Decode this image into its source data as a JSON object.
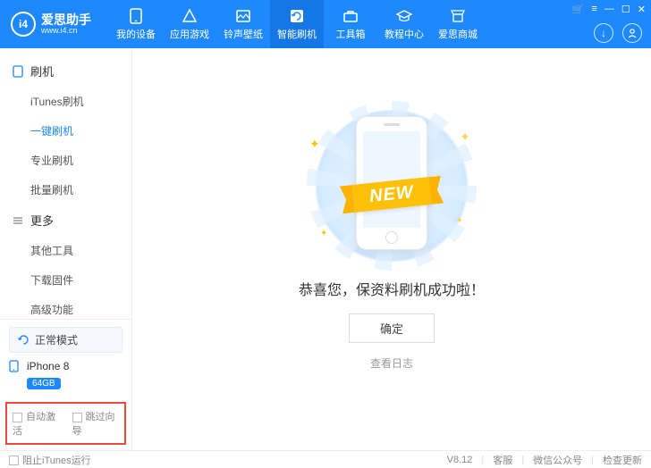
{
  "brand": {
    "name": "爱思助手",
    "site": "www.i4.cn",
    "badge": "i4"
  },
  "win": [
    "🛒",
    "≡",
    "—",
    "☐",
    "✕"
  ],
  "nav": [
    {
      "key": "device",
      "label": "我的设备"
    },
    {
      "key": "apps",
      "label": "应用游戏"
    },
    {
      "key": "ring",
      "label": "铃声壁纸"
    },
    {
      "key": "flash",
      "label": "智能刷机"
    },
    {
      "key": "tools",
      "label": "工具箱"
    },
    {
      "key": "tutorial",
      "label": "教程中心"
    },
    {
      "key": "mall",
      "label": "爱思商城"
    }
  ],
  "activeNav": 3,
  "sidebar": {
    "groups": [
      {
        "title": "刷机",
        "items": [
          "iTunes刷机",
          "一键刷机",
          "专业刷机",
          "批量刷机"
        ],
        "selected": 1
      },
      {
        "title": "更多",
        "items": [
          "其他工具",
          "下载固件",
          "高级功能"
        ],
        "selected": -1
      }
    ]
  },
  "mode": "正常模式",
  "device": {
    "name": "iPhone 8",
    "capacity": "64GB"
  },
  "opts": {
    "autoActivate": "自动激活",
    "skipGuide": "跳过向导"
  },
  "main": {
    "ribbon": "NEW",
    "message": "恭喜您，保资料刷机成功啦！",
    "ok": "确定",
    "log": "查看日志"
  },
  "footer": {
    "block": "阻止iTunes运行",
    "version": "V8.12",
    "support": "客服",
    "wechat": "微信公众号",
    "update": "检查更新"
  }
}
